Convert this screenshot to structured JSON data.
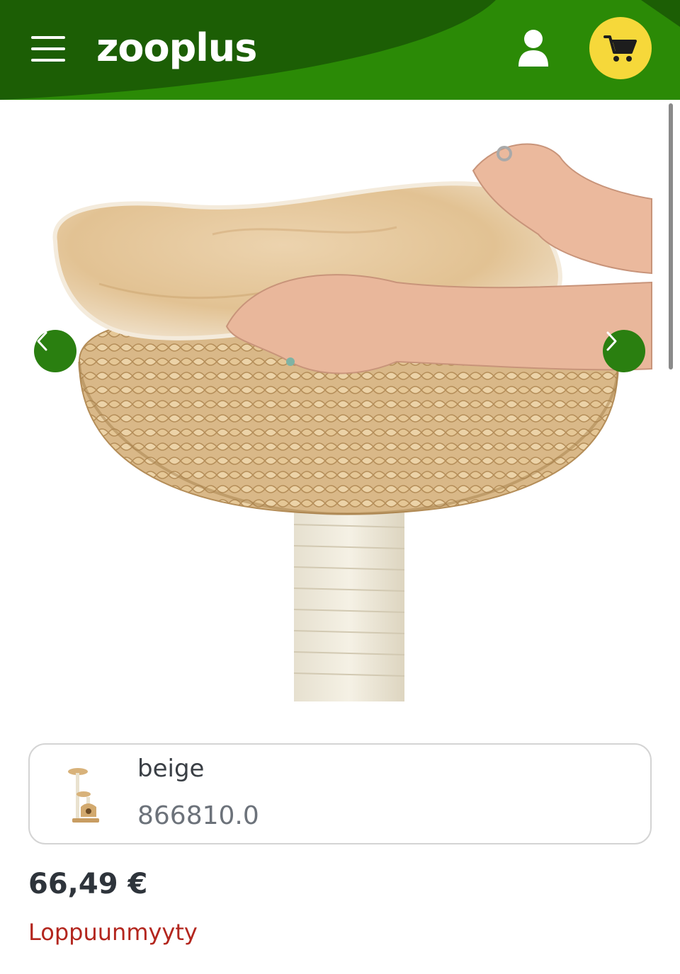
{
  "header": {
    "logo_text": "zooplus",
    "menu_icon": "hamburger-menu-icon",
    "account_icon": "user-icon",
    "cart_icon": "shopping-cart-icon",
    "colors": {
      "bar": "#2b8a06",
      "wave": "#1c5e05",
      "cart_bg": "#f6d83a"
    }
  },
  "gallery": {
    "prev_icon": "chevron-left-icon",
    "next_icon": "chevron-right-icon",
    "image_subject": "woven water hyacinth basket bed with beige plush cushion on sisal post"
  },
  "variant": {
    "name": "beige",
    "sku": "866810.0",
    "thumbnail_icon": "cat-tree-thumbnail"
  },
  "product": {
    "price": "66,49 €",
    "stock_status": "Loppuunmyyty"
  }
}
